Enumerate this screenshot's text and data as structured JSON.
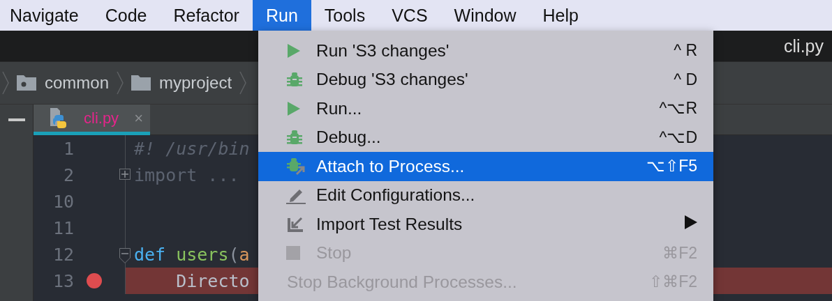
{
  "menu_bar": [
    {
      "label": "Navigate",
      "selected": false
    },
    {
      "label": "Code",
      "selected": false
    },
    {
      "label": "Refactor",
      "selected": false
    },
    {
      "label": "Run",
      "selected": true
    },
    {
      "label": "Tools",
      "selected": false
    },
    {
      "label": "VCS",
      "selected": false
    },
    {
      "label": "Window",
      "selected": false
    },
    {
      "label": "Help",
      "selected": false
    }
  ],
  "title_bar": {
    "title_end": "cli.py"
  },
  "breadcrumbs": [
    {
      "label": "common",
      "kind": "module"
    },
    {
      "label": "myproject",
      "kind": "folder"
    }
  ],
  "editor_tabs": [
    {
      "label": "cli.py",
      "close": "×",
      "selected": true
    }
  ],
  "editor": {
    "lines": [
      {
        "number": "1",
        "breakpoint": false,
        "highlighted": false,
        "collapsed": false,
        "expanded": false,
        "tokens": [
          {
            "text": "#! /usr/bin",
            "kind": "comment"
          }
        ]
      },
      {
        "number": "2",
        "breakpoint": false,
        "highlighted": false,
        "collapsed": true,
        "expanded": false,
        "tokens": [
          {
            "text": "import ...",
            "kind": "folded"
          }
        ]
      },
      {
        "number": "10",
        "breakpoint": false,
        "highlighted": false,
        "collapsed": false,
        "expanded": false
      },
      {
        "number": "11",
        "breakpoint": false,
        "highlighted": false,
        "collapsed": false,
        "expanded": false
      },
      {
        "number": "12",
        "breakpoint": false,
        "highlighted": false,
        "collapsed": false,
        "expanded": true,
        "tokens": [
          {
            "text": "def ",
            "kind": "keyword"
          },
          {
            "text": "users",
            "kind": "function"
          },
          {
            "text": "(",
            "kind": "paren"
          },
          {
            "text": "a",
            "kind": "param"
          }
        ]
      },
      {
        "number": "13",
        "breakpoint": true,
        "highlighted": true,
        "collapsed": false,
        "expanded": false,
        "tokens": [
          {
            "text": "    Directo",
            "kind": "plain"
          }
        ]
      }
    ]
  },
  "run_menu": {
    "items": [
      {
        "label": "Run 'S3 changes'",
        "shortcut": "^ R",
        "kind": "run",
        "submenu": false,
        "disabled": false,
        "selected": false
      },
      {
        "label": "Debug 'S3 changes'",
        "shortcut": "^ D",
        "kind": "debug",
        "submenu": false,
        "disabled": false,
        "selected": false
      },
      {
        "label": "Run...",
        "shortcut": "^⌥R",
        "kind": "run",
        "submenu": false,
        "disabled": false,
        "selected": false
      },
      {
        "label": "Debug...",
        "shortcut": "^⌥D",
        "kind": "debug",
        "submenu": false,
        "disabled": false,
        "selected": false
      },
      {
        "label": "Attach to Process...",
        "shortcut": "⌥⇧F5",
        "kind": "attach",
        "submenu": false,
        "disabled": false,
        "selected": true
      },
      {
        "label": "Edit Configurations...",
        "kind": "edit",
        "submenu": false,
        "disabled": false,
        "selected": false
      },
      {
        "label": "Import Test Results",
        "kind": "import",
        "submenu": true,
        "disabled": false,
        "selected": false
      },
      {
        "label": "Stop",
        "shortcut": "⌘F2",
        "kind": "stop",
        "submenu": false,
        "disabled": true,
        "selected": false
      },
      {
        "label": "Stop Background Processes...",
        "shortcut": "⇧⌘F2",
        "kind": "text",
        "submenu": false,
        "disabled": true,
        "selected": false
      }
    ]
  }
}
